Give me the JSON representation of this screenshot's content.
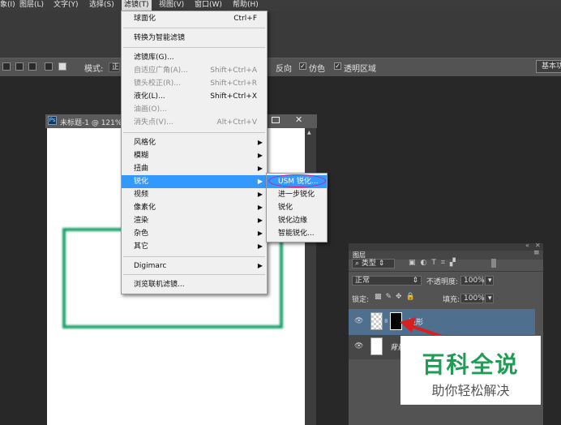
{
  "menubar": {
    "items": [
      {
        "label": "象(I)"
      },
      {
        "label": "图层(L)"
      },
      {
        "label": "文字(Y)"
      },
      {
        "label": "选择(S)"
      },
      {
        "label": "滤镜(T)"
      },
      {
        "label": "视图(V)"
      },
      {
        "label": "窗口(W)"
      },
      {
        "label": "帮助(H)"
      }
    ]
  },
  "options_bar": {
    "mode_label": "模式:",
    "mode_value": "正",
    "reverse_label": "反向",
    "dither_label": "仿色",
    "transparency_label": "透明区域",
    "workspace_button": "基本功"
  },
  "document": {
    "tab_title": "未标题-1 @ 121%",
    "ps_badge": "Ps",
    "shape_color": "#19a06a"
  },
  "filter_menu": {
    "items": [
      {
        "label": "球面化",
        "shortcut": "Ctrl+F"
      },
      {
        "label": "转换为智能滤镜"
      },
      {
        "label": "滤镜库(G)..."
      },
      {
        "label": "自适应广角(A)...",
        "shortcut": "Shift+Ctrl+A"
      },
      {
        "label": "镜头校正(R)...",
        "shortcut": "Shift+Ctrl+R"
      },
      {
        "label": "液化(L)...",
        "shortcut": "Shift+Ctrl+X"
      },
      {
        "label": "油画(O)..."
      },
      {
        "label": "消失点(V)...",
        "shortcut": "Alt+Ctrl+V"
      },
      {
        "label": "风格化"
      },
      {
        "label": "模糊"
      },
      {
        "label": "扭曲"
      },
      {
        "label": "锐化"
      },
      {
        "label": "视频"
      },
      {
        "label": "像素化"
      },
      {
        "label": "渲染"
      },
      {
        "label": "杂色"
      },
      {
        "label": "其它"
      },
      {
        "label": "Digimarc"
      },
      {
        "label": "浏览联机滤镜..."
      }
    ]
  },
  "sharpen_submenu": {
    "items": [
      {
        "label": "USM 锐化..."
      },
      {
        "label": "进一步锐化"
      },
      {
        "label": "锐化"
      },
      {
        "label": "锐化边缘"
      },
      {
        "label": "智能锐化..."
      }
    ]
  },
  "layers_panel": {
    "tab": "图层",
    "filter_kind": "类型",
    "blend_mode": "正常",
    "opacity_label": "不透明度:",
    "opacity_value": "100%",
    "lock_label": "锁定:",
    "fill_label": "填充:",
    "fill_value": "100%",
    "layers": [
      {
        "name": "矩形"
      },
      {
        "name": "背景"
      }
    ]
  },
  "watermark": {
    "title": "百科全说",
    "subtitle": "助你轻松解决"
  },
  "colors": {
    "menu_highlight": "#3399ff",
    "annotation_red": "#d8201f",
    "annotation_ring": "#d81a7a",
    "watermark_green": "#1e9e55"
  }
}
